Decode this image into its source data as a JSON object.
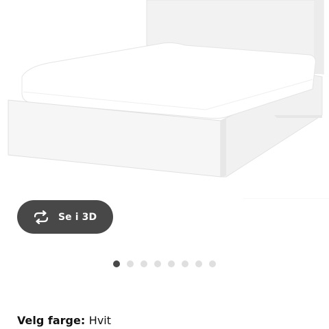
{
  "product_image": {
    "icon": "white-bed-frame-with-mattress"
  },
  "view_3d_button": {
    "icon": "rotate-arrows-icon",
    "label": "Se i 3D",
    "background": "#484848"
  },
  "carousel": {
    "dot_count": 8,
    "active_index": 0,
    "active_color": "#484848",
    "inactive_color": "#dfdfdf"
  },
  "color_selector": {
    "label": "Velg farge:",
    "value": "Hvit"
  }
}
